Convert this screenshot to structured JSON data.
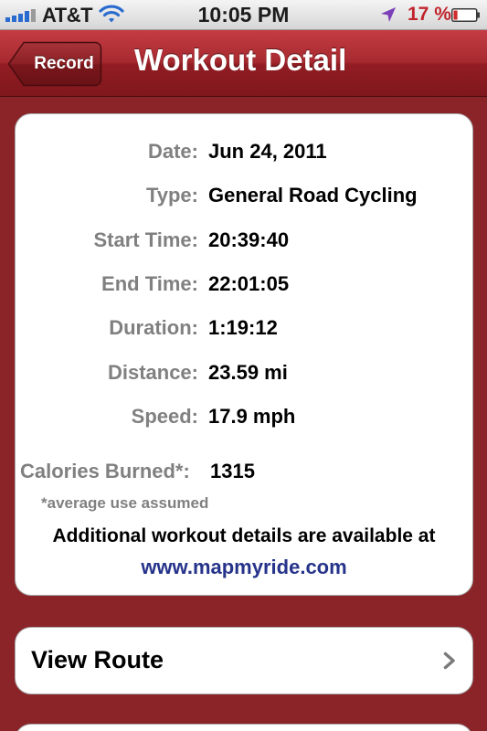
{
  "status_bar": {
    "carrier": "AT&T",
    "time": "10:05 PM",
    "battery_percent": "17 %",
    "battery_level": 0.17,
    "signal_icon": "signal-bars-icon",
    "wifi_icon": "wifi-icon",
    "location_icon": "location-arrow-icon",
    "battery_icon": "battery-icon"
  },
  "nav": {
    "back_label": "Record",
    "title": "Workout Detail"
  },
  "details": [
    {
      "label": "Date:",
      "value": "Jun 24, 2011"
    },
    {
      "label": "Type:",
      "value": "General Road Cycling"
    },
    {
      "label": "Start Time:",
      "value": "20:39:40"
    },
    {
      "label": "End Time:",
      "value": "22:01:05"
    },
    {
      "label": "Duration:",
      "value": "1:19:12"
    },
    {
      "label": "Distance:",
      "value": "23.59 mi"
    },
    {
      "label": "Speed:",
      "value": "17.9 mph"
    }
  ],
  "calories": {
    "label": "Calories Burned*:",
    "value": "1315",
    "footnote": "*average use assumed"
  },
  "more_info": {
    "text": "Additional workout details are available at",
    "link": "www.mapmyride.com"
  },
  "route": {
    "label": "View Route",
    "icon": "chevron-right-icon"
  },
  "colors": {
    "nav_red": "#a72a30",
    "background": "#8a2429",
    "label_gray": "#808080",
    "link_blue": "#26338a",
    "battery_red": "#c0242c"
  }
}
